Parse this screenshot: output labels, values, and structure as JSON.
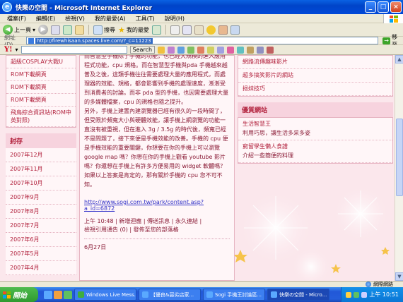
{
  "window": {
    "title": "快樂の空間 - Microsoft Internet Explorer",
    "controls": [
      "_",
      "□",
      "×"
    ]
  },
  "menu": [
    "檔案(F)",
    "編輯(E)",
    "檢視(V)",
    "我的最愛(A)",
    "工具(T)",
    "說明(H)"
  ],
  "toolbar": {
    "back_label": "上一頁",
    "search_label": "搜尋",
    "favorites_label": "我的最愛"
  },
  "address": {
    "label": "網址(D)",
    "url": "http://firewhisaan.spaces.live.com/?_c=11223",
    "go_label": "移至"
  },
  "yahoo": {
    "logo": "Y!",
    "search_label": "Search"
  },
  "left_sidebar": {
    "links": [
      "超級COSPLAY大戰U",
      "ROM下載網頁",
      "ROM下載網頁",
      "ROM下載網頁",
      "飛鳥綜合資訊站(ROM中英對照)"
    ],
    "archive_title": "封存",
    "archive": [
      "2007年12月",
      "2007年11月",
      "2007年10月",
      "2007年9月",
      "2007年8月",
      "2007年7月",
      "2007年6月",
      "2007年5月",
      "2007年4月"
    ]
  },
  "post": {
    "paragraph1": "而智慧型手機除了手機的功能，也已經大規模的進入應用程式功能，cpu 規格。而在智慧型手機與pda 手機越來越普及之後，這類手機往往需要處理大量的應用程式，而處理器的效能、規格，都會影響到手機的處理速度，漸漸受到消費者的討論。而非 pda 型的手機，也因需要處理大量的多媒體檔案，cpu 的規格也隨之提升。",
    "paragraph2": "另外，手機上建置內建瀏覽器已經有很久的一段時間了，但受限於頻寬大小與硬體效能，讓手機上網瀏覽的功能一直沒有被重視，但在進入 3g / 3.5g 的時代後，頻寬已經不是問題了，接下來便是手機效能的改善。手機的 cpu 便是手機效能的重要關鍵，你想要在你的手機上可以瀏覽 google map 嗎？你想在你的手機上觀看 youtube 影片嗎？你還想在手機上有許多方便易用的 widget 軟體嗎？如果以上答案是肯定的，那有關於手機的 cpu 您不可不知。",
    "link": "http://www.sogi.com.tw/park/content.asp?a_id=6872",
    "meta1": "上午 10:48 | 新增迴應 | 傳送訊息 | 永久連結 |",
    "meta2": "檢視引用通告 (0) | 發佈至您的部落格",
    "next_date": "6月27日"
  },
  "right_sidebar": {
    "links": [
      "網路流傳趣味影片",
      "超多搞笑影片的網站",
      "挹妹技巧"
    ],
    "quality_title": "優質網站",
    "sites": [
      {
        "name": "生活智慧王",
        "desc": "利用巧思，讓生活多采多姿"
      },
      {
        "name": "窮留學生懶人食譜",
        "desc": "介紹一些簡便的料理"
      }
    ]
  },
  "status": {
    "zone": "網際網路"
  },
  "taskbar": {
    "start": "開始",
    "tasks": [
      "Windows Live Mess...",
      "【優良&惡劣店家...",
      "Sogi 手機王討論區...",
      "快樂の空間 - Micro..."
    ],
    "time": "上午 10:51"
  }
}
